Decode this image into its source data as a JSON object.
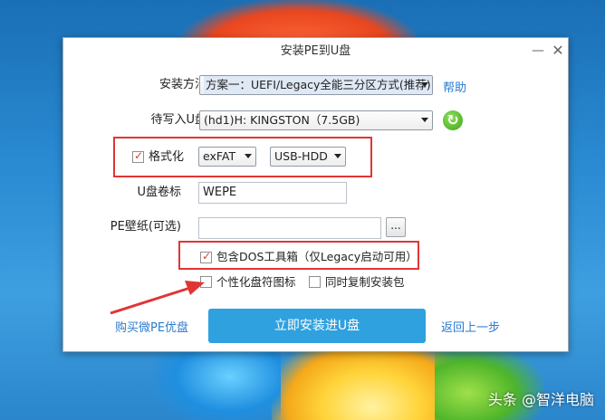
{
  "window": {
    "title": "安装PE到U盘",
    "min_symbol": "—",
    "close_symbol": "✕"
  },
  "install_method": {
    "label": "安装方法",
    "value": "方案一：UEFI/Legacy全能三分区方式(推荐)",
    "help_label": "帮助"
  },
  "target_disk": {
    "label": "待写入U盘",
    "value": "(hd1)H: KINGSTON（7.5GB)"
  },
  "format": {
    "label": "格式化",
    "checked": true,
    "filesystem": "exFAT",
    "mode": "USB-HDD"
  },
  "volume_label": {
    "label": "U盘卷标",
    "value": "WEPE"
  },
  "wallpaper": {
    "label": "PE壁纸(可选)",
    "value": "",
    "browse_label": "..."
  },
  "options": {
    "dos_toolbox": {
      "label": "包含DOS工具箱（仅Legacy启动可用）",
      "checked": true
    },
    "personalize_icon": {
      "label": "个性化盘符图标",
      "checked": false
    },
    "copy_installer": {
      "label": "同时复制安装包",
      "checked": false
    }
  },
  "footer": {
    "buy_link": "购买微PE优盘",
    "install_button": "立即安装进U盘",
    "back_link": "返回上一步"
  },
  "desktop": {
    "watermark": "头条 @智洋电脑"
  },
  "colors": {
    "accent": "#2fa1df",
    "link": "#2a7bd0",
    "annotation_red": "#e03535"
  }
}
